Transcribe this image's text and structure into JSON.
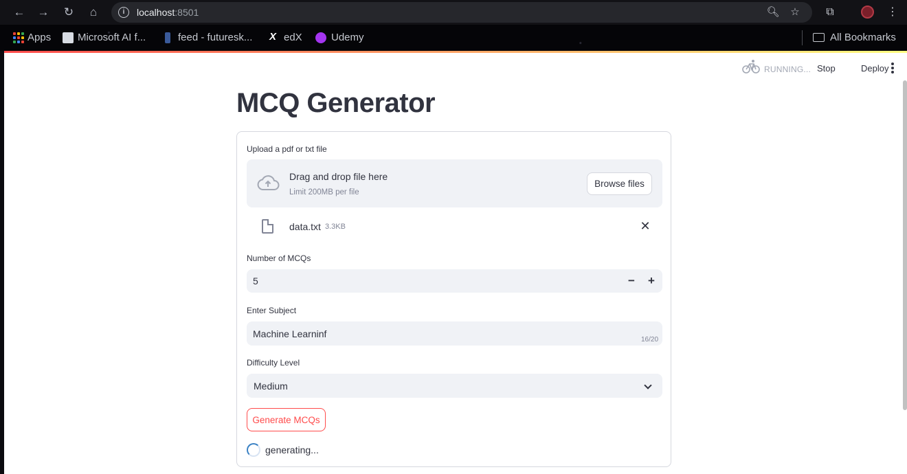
{
  "browser": {
    "url_host": "localhost",
    "url_port": ":8501",
    "bookmarks": [
      {
        "label": "Apps"
      },
      {
        "label": "Microsoft AI f..."
      },
      {
        "label": "feed - futuresk..."
      },
      {
        "label": "edX"
      },
      {
        "label": "Udemy"
      }
    ],
    "all_bookmarks": "All Bookmarks"
  },
  "header": {
    "status": "RUNNING...",
    "stop_label": "Stop",
    "deploy_label": "Deploy"
  },
  "app": {
    "title": "MCQ Generator",
    "upload": {
      "label": "Upload a pdf or txt file",
      "drop_text": "Drag and drop file here",
      "limit_text": "Limit 200MB per file",
      "browse_label": "Browse files",
      "file_name": "data.txt",
      "file_size": "3.3KB"
    },
    "mcq_count": {
      "label": "Number of MCQs",
      "value": "5",
      "minus": "−",
      "plus": "+"
    },
    "subject": {
      "label": "Enter Subject",
      "value": "Machine Learninf",
      "counter": "16/20"
    },
    "difficulty": {
      "label": "Difficulty Level",
      "selected": "Medium"
    },
    "generate_label": "Generate MCQs",
    "progress_text": "generating..."
  },
  "colors": {
    "accent": "#ff4b4b",
    "field_bg": "#f0f2f6",
    "text": "#31333f",
    "muted": "#808495"
  }
}
